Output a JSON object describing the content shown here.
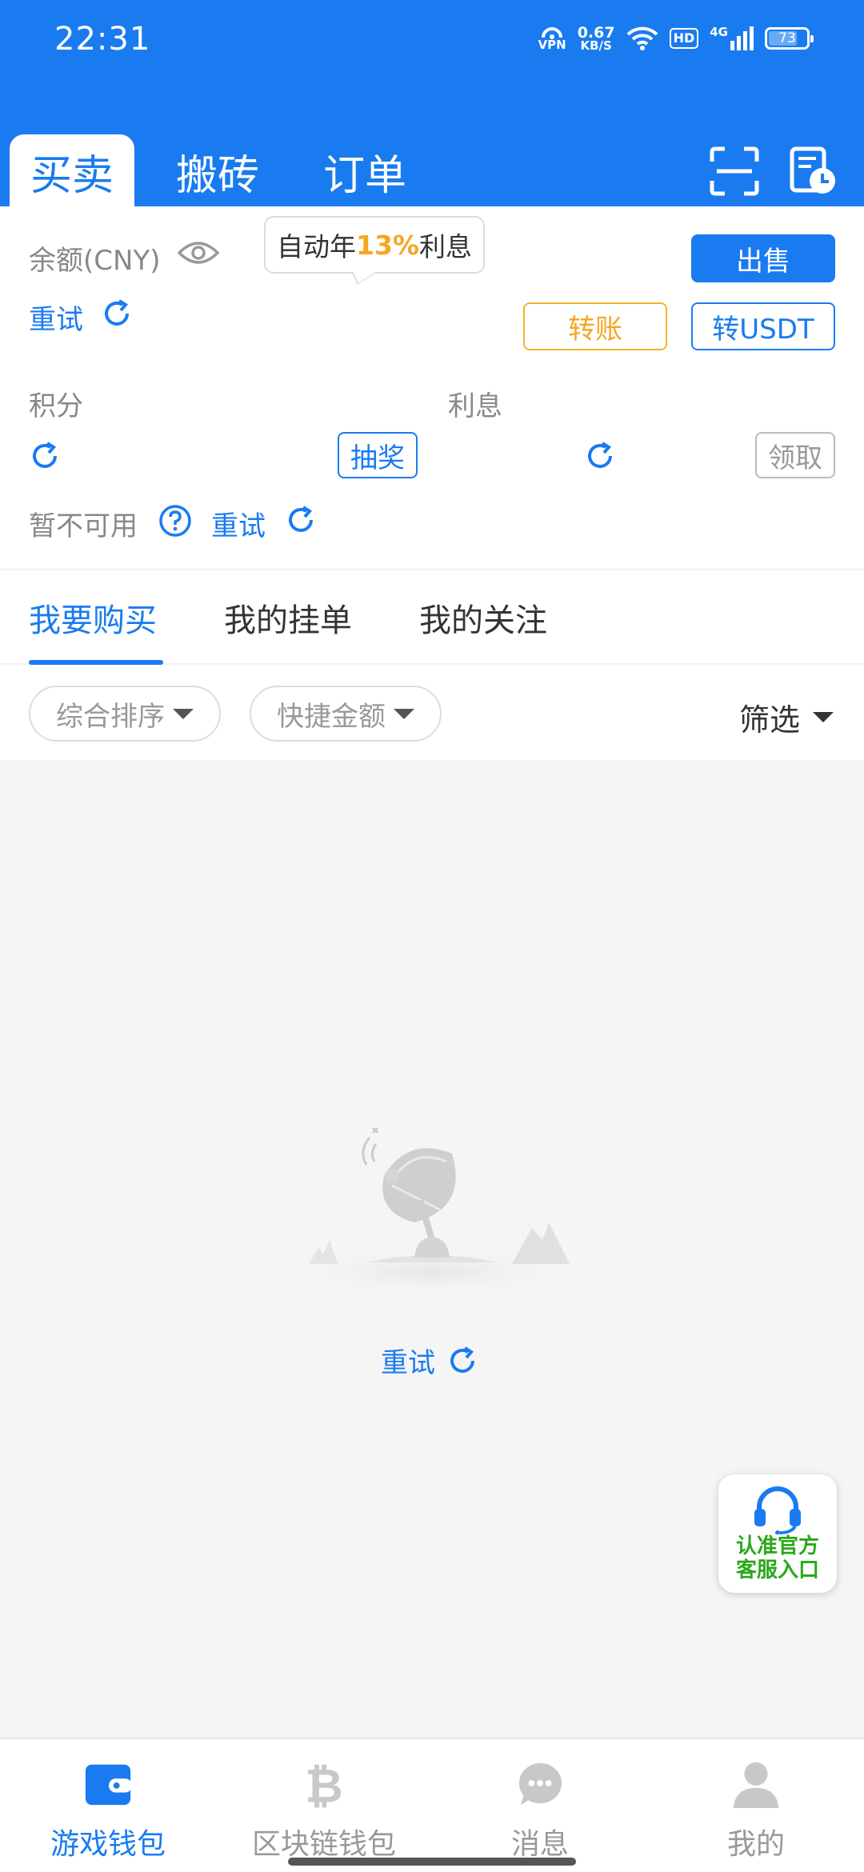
{
  "status_bar": {
    "time": "22:31",
    "vpn": "VPN",
    "speed_value": "0.67",
    "speed_unit": "KB/S",
    "hd": "HD",
    "network": "4G",
    "battery": "73"
  },
  "header": {
    "tabs": [
      {
        "label": "买卖",
        "active": true
      },
      {
        "label": "搬砖",
        "active": false
      },
      {
        "label": "订单",
        "active": false
      }
    ],
    "icons": [
      "scan-icon",
      "history-icon"
    ]
  },
  "account": {
    "balance_label": "余额(CNY)",
    "tooltip_prefix": "自动年",
    "tooltip_rate": "13%",
    "tooltip_suffix": "利息",
    "retry": "重试",
    "sell": "出售",
    "transfer": "转账",
    "to_usdt": "转USDT",
    "points_label": "积分",
    "interest_label": "利息",
    "lottery": "抽奖",
    "claim": "领取",
    "unavailable": "暂不可用",
    "retry2": "重试"
  },
  "subtabs": [
    {
      "label": "我要购买",
      "active": true
    },
    {
      "label": "我的挂单",
      "active": false
    },
    {
      "label": "我的关注",
      "active": false
    }
  ],
  "filters": {
    "sort": "综合排序",
    "quick_amount": "快捷金额",
    "filter": "筛选"
  },
  "empty_state": {
    "retry": "重试"
  },
  "service": {
    "line1": "认准官方",
    "line2": "客服入口"
  },
  "bottom_nav": [
    {
      "label": "游戏钱包",
      "icon": "wallet-icon",
      "active": true
    },
    {
      "label": "区块链钱包",
      "icon": "bitcoin-icon",
      "active": false
    },
    {
      "label": "消息",
      "icon": "chat-icon",
      "active": false
    },
    {
      "label": "我的",
      "icon": "user-icon",
      "active": false
    }
  ],
  "colors": {
    "primary": "#1a7bf0",
    "accent_orange": "#f5a623",
    "service_green": "#2aa81a"
  }
}
